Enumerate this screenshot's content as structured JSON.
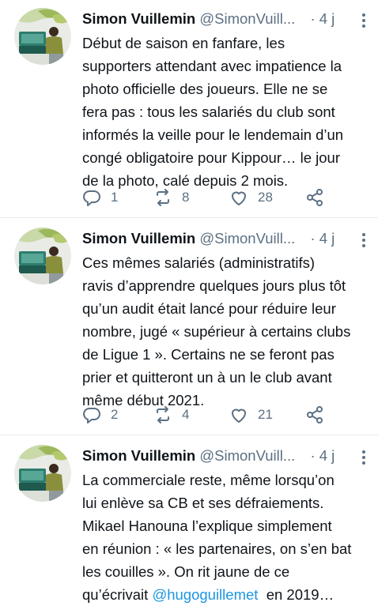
{
  "tweets": [
    {
      "name": "Simon Vuillemin",
      "handle": "@SimonVuill...",
      "time": "4 j",
      "lines": [
        "Début de saison en fanfare, les",
        "supporters attendant avec impatience la",
        "photo officielle des joueurs. Elle ne se",
        "fera pas : tous les salariés du club sont",
        "informés la veille pour le lendemain d’un",
        "congé obligatoire pour Kippour… le jour",
        "de la photo, calé depuis 2 mois."
      ],
      "replies": "1",
      "retweets": "8",
      "likes": "28"
    },
    {
      "name": "Simon Vuillemin",
      "handle": "@SimonVuill...",
      "time": "4 j",
      "lines": [
        "Ces mêmes salariés (administratifs)",
        "ravis d’apprendre quelques jours plus tôt",
        "qu’un audit était lancé pour réduire leur",
        "nombre, jugé « supérieur à certains clubs",
        "de Ligue 1 ». Certains ne se feront pas",
        "prier et quitteront un à un le club avant",
        "même début 2021."
      ],
      "replies": "2",
      "retweets": "4",
      "likes": "21"
    },
    {
      "name": "Simon Vuillemin",
      "handle": "@SimonVuill...",
      "time": "4 j",
      "lines": [
        "La commerciale reste, même lorsqu’on",
        "lui enlève sa CB et ses défraiements.",
        "Mikael Hanouna l’explique simplement",
        "en réunion : « les partenaires, on s’en bat",
        "les couilles ». On rit jaune de ce"
      ],
      "last_line_prefix": "qu’écrivait ",
      "last_line_mention": "@hugoguillemet",
      "last_line_suffix": "  en 2019…"
    }
  ],
  "colors": {
    "text": "#0f1419",
    "secondary": "#5b7083",
    "link": "#1b95e0",
    "divider": "#e6ecf0"
  },
  "icons": [
    "reply-icon",
    "retweet-icon",
    "like-icon",
    "share-icon",
    "more-icon"
  ]
}
